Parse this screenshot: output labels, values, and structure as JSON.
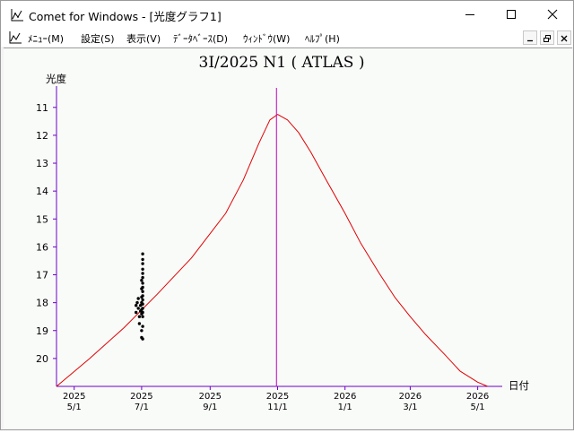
{
  "window": {
    "title": "Comet for Windows - [光度グラフ1]"
  },
  "menu": {
    "items": [
      {
        "label": "ﾒﾆｭｰ(M)"
      },
      {
        "label": "設定(S)"
      },
      {
        "label": "表示(V)"
      },
      {
        "label": "ﾃﾞｰﾀﾍﾞｰｽ(D)"
      },
      {
        "label": "ｳｨﾝﾄﾞｳ(W)"
      },
      {
        "label": "ﾍﾙﾌﾟ(H)"
      }
    ]
  },
  "icons": {
    "app": "graph-app-icon",
    "minimize": "minimize-icon",
    "maximize": "maximize-icon",
    "close": "close-icon",
    "child_minimize": "child-minimize-icon",
    "child_restore": "child-restore-icon",
    "child_close": "child-close-icon"
  },
  "colors": {
    "curve": "#e00000",
    "peak_line": "#c000c0",
    "axis": "#6a00c8",
    "observations": "#000000",
    "background": "#f9fbf9"
  },
  "chart_data": {
    "type": "line",
    "title": "3I/2025 N1 ( ATLAS )",
    "ylabel": "光度",
    "xlabel": "日付",
    "y_inverted": true,
    "ylim": [
      21.0,
      10.3
    ],
    "yticks": [
      11,
      12,
      13,
      14,
      15,
      16,
      17,
      18,
      19,
      20
    ],
    "xlim": [
      "2025-04-15",
      "2026-05-20"
    ],
    "xticks": [
      {
        "date": "2025-05-01",
        "year": "2025",
        "md": "5/1"
      },
      {
        "date": "2025-07-01",
        "year": "2025",
        "md": "7/1"
      },
      {
        "date": "2025-09-01",
        "year": "2025",
        "md": "9/1"
      },
      {
        "date": "2025-11-01",
        "year": "2025",
        "md": "11/1"
      },
      {
        "date": "2026-01-01",
        "year": "2026",
        "md": "1/1"
      },
      {
        "date": "2026-03-01",
        "year": "2026",
        "md": "3/1"
      },
      {
        "date": "2026-05-01",
        "year": "2026",
        "md": "5/1"
      }
    ],
    "peak_date": "2025-10-31",
    "series": [
      {
        "points": [
          [
            "2025-04-15",
            21.0
          ],
          [
            "2025-05-15",
            20.0
          ],
          [
            "2025-06-15",
            18.9
          ],
          [
            "2025-07-15",
            17.7
          ],
          [
            "2025-08-15",
            16.4
          ],
          [
            "2025-09-15",
            14.8
          ],
          [
            "2025-10-01",
            13.6
          ],
          [
            "2025-10-15",
            12.3
          ],
          [
            "2025-10-25",
            11.45
          ],
          [
            "2025-11-01",
            11.25
          ],
          [
            "2025-11-10",
            11.45
          ],
          [
            "2025-11-20",
            11.9
          ],
          [
            "2025-12-01",
            12.6
          ],
          [
            "2025-12-15",
            13.6
          ],
          [
            "2026-01-01",
            14.8
          ],
          [
            "2026-01-15",
            15.85
          ],
          [
            "2026-02-01",
            16.95
          ],
          [
            "2026-02-15",
            17.8
          ],
          [
            "2026-03-01",
            18.5
          ],
          [
            "2026-03-15",
            19.15
          ],
          [
            "2026-04-01",
            19.85
          ],
          [
            "2026-04-15",
            20.45
          ],
          [
            "2026-05-01",
            20.85
          ],
          [
            "2026-05-10",
            21.0
          ]
        ]
      }
    ],
    "observations": [
      [
        "2025-06-26",
        18.1
      ],
      [
        "2025-06-26",
        18.35
      ],
      [
        "2025-06-27",
        18.0
      ],
      [
        "2025-06-28",
        17.85
      ],
      [
        "2025-06-28",
        18.2
      ],
      [
        "2025-06-29",
        18.5
      ],
      [
        "2025-06-29",
        18.75
      ],
      [
        "2025-06-30",
        18.1
      ],
      [
        "2025-06-30",
        18.3
      ],
      [
        "2025-07-01",
        17.2
      ],
      [
        "2025-07-01",
        17.5
      ],
      [
        "2025-07-01",
        17.8
      ],
      [
        "2025-07-01",
        18.0
      ],
      [
        "2025-07-01",
        18.25
      ],
      [
        "2025-07-01",
        18.4
      ],
      [
        "2025-07-01",
        19.0
      ],
      [
        "2025-07-01",
        19.25
      ],
      [
        "2025-07-02",
        16.25
      ],
      [
        "2025-07-02",
        16.45
      ],
      [
        "2025-07-02",
        16.6
      ],
      [
        "2025-07-02",
        16.8
      ],
      [
        "2025-07-02",
        16.95
      ],
      [
        "2025-07-02",
        17.1
      ],
      [
        "2025-07-02",
        17.3
      ],
      [
        "2025-07-02",
        17.45
      ],
      [
        "2025-07-02",
        17.6
      ],
      [
        "2025-07-02",
        17.75
      ],
      [
        "2025-07-02",
        17.9
      ],
      [
        "2025-07-02",
        18.05
      ],
      [
        "2025-07-02",
        18.2
      ],
      [
        "2025-07-02",
        18.35
      ],
      [
        "2025-07-02",
        18.5
      ],
      [
        "2025-07-02",
        18.85
      ],
      [
        "2025-07-02",
        19.3
      ]
    ]
  }
}
